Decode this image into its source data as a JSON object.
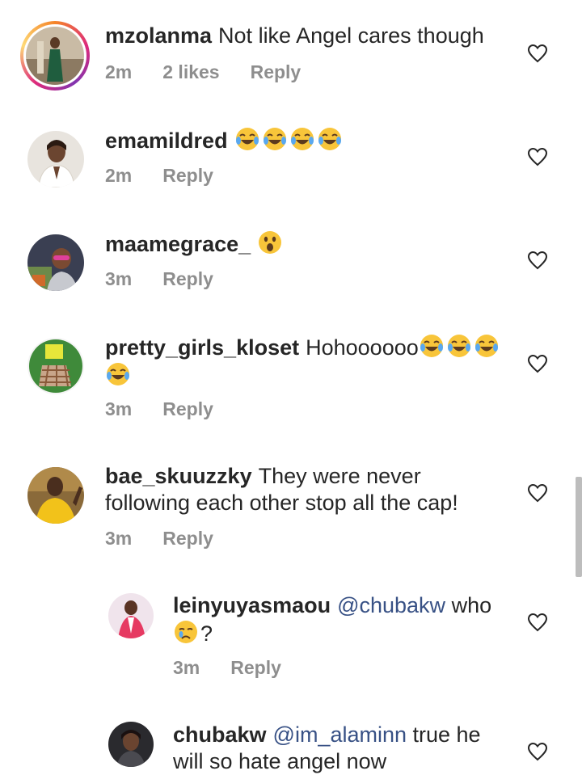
{
  "comments": [
    {
      "username": "mzolanma",
      "text": "Not like Angel cares though",
      "time": "2m",
      "likes": "2 likes",
      "reply": "Reply"
    },
    {
      "username": "emamildred",
      "text": "",
      "emojis": [
        "joy",
        "joy",
        "joy",
        "joy"
      ],
      "time": "2m",
      "reply": "Reply"
    },
    {
      "username": "maamegrace_",
      "text": "",
      "emojis": [
        "astonished"
      ],
      "time": "3m",
      "reply": "Reply"
    },
    {
      "username": "pretty_girls_kloset",
      "text": "Hohoooooo",
      "emojis": [
        "joy",
        "joy",
        "joy",
        "joy"
      ],
      "time": "3m",
      "reply": "Reply"
    },
    {
      "username": "bae_skuuzzky",
      "text": "They were never following each other stop all the cap!",
      "time": "3m",
      "reply": "Reply"
    }
  ],
  "replies": [
    {
      "username": "leinyuyasmaou",
      "mention": "@chubakw",
      "text": " who",
      "emojis": [
        "crying"
      ],
      "tail": "?",
      "time": "3m",
      "reply": "Reply"
    },
    {
      "username": "chubakw",
      "mention": "@im_alaminn",
      "text": " true he will so hate angel now"
    }
  ],
  "icons": {
    "like": "heart-outline-icon",
    "joy": "face-with-tears-of-joy-emoji",
    "astonished": "astonished-face-emoji",
    "crying": "crying-face-emoji"
  },
  "colors": {
    "text": "#262626",
    "meta": "#8e8e8e",
    "mention": "#385185"
  }
}
